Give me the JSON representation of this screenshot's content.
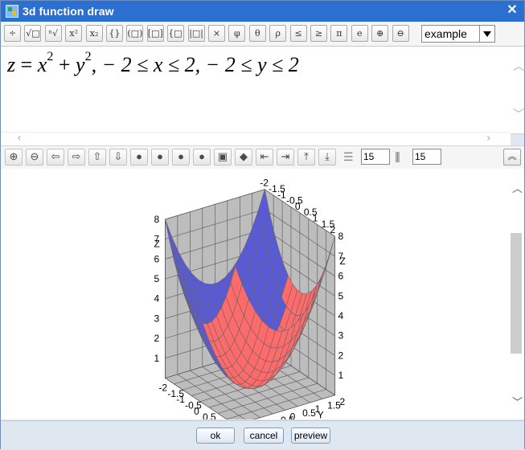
{
  "window": {
    "title": "3d function draw",
    "close_label": "✕"
  },
  "toolbar1": {
    "buttons": [
      {
        "name": "fraction-button",
        "glyph": "÷"
      },
      {
        "name": "sqrt-button",
        "glyph": "√□"
      },
      {
        "name": "nth-root-button",
        "glyph": "ⁿ√"
      },
      {
        "name": "superscript-button",
        "glyph": "x²"
      },
      {
        "name": "subscript-button",
        "glyph": "x₂"
      },
      {
        "name": "brace-button",
        "glyph": "{}"
      },
      {
        "name": "paren-button",
        "glyph": "(□)"
      },
      {
        "name": "bracket-button",
        "glyph": "[□]"
      },
      {
        "name": "curly-bracket-button",
        "glyph": "{□}"
      },
      {
        "name": "abs-button",
        "glyph": "|□|"
      },
      {
        "name": "times-button",
        "glyph": "×"
      },
      {
        "name": "phi-button",
        "glyph": "φ"
      },
      {
        "name": "theta-button",
        "glyph": "θ"
      },
      {
        "name": "rho-button",
        "glyph": "ρ"
      },
      {
        "name": "leq-button",
        "glyph": "≤"
      },
      {
        "name": "geq-button",
        "glyph": "≥"
      },
      {
        "name": "pi-button",
        "glyph": "π"
      },
      {
        "name": "e-button",
        "glyph": "e"
      },
      {
        "name": "zoom-in-button",
        "glyph": "⊕"
      },
      {
        "name": "zoom-out-button",
        "glyph": "⊖"
      }
    ],
    "example_select": "example"
  },
  "formula": {
    "z": "z",
    "eq": " = ",
    "x": "x",
    "exp1": "2",
    "plus": " + ",
    "y": "y",
    "exp2": "2",
    "rest": ", − 2 ≤ x ≤ 2, − 2 ≤ y ≤ 2"
  },
  "toolbar2": {
    "buttons": [
      {
        "name": "zoom-in-button",
        "glyph": "⊕"
      },
      {
        "name": "zoom-out-button",
        "glyph": "⊖"
      },
      {
        "name": "arrow-left-button",
        "glyph": "⇦"
      },
      {
        "name": "arrow-right-button",
        "glyph": "⇨"
      },
      {
        "name": "arrow-up-button",
        "glyph": "⇧"
      },
      {
        "name": "arrow-down-button",
        "glyph": "⇩"
      },
      {
        "name": "sphere-1-button",
        "glyph": "●"
      },
      {
        "name": "sphere-2-button",
        "glyph": "●"
      },
      {
        "name": "sphere-3-button",
        "glyph": "●"
      },
      {
        "name": "sphere-4-button",
        "glyph": "●"
      },
      {
        "name": "cube-button",
        "glyph": "▣"
      },
      {
        "name": "small-cube-button",
        "glyph": "◆"
      },
      {
        "name": "move-left-button",
        "glyph": "⇤"
      },
      {
        "name": "move-right-button",
        "glyph": "⇥"
      },
      {
        "name": "move-top-button",
        "glyph": "⤒"
      },
      {
        "name": "move-bottom-button",
        "glyph": "⤓"
      }
    ],
    "grid_x": "15",
    "grid_y": "15",
    "collapse_label": "︽"
  },
  "plot": {
    "x_axis": "X",
    "y_axis": "Y",
    "z_axis": "Z",
    "x_ticks": [
      "-2",
      "-1.5",
      "-1",
      "-0.5",
      "0",
      "0.5",
      "1",
      "1.5",
      "2"
    ],
    "y_ticks": [
      "-2",
      "-1.5",
      "-1",
      "-0.5",
      "0",
      "0.5",
      "1",
      "1.5",
      "2"
    ],
    "z_ticks": [
      "1",
      "2",
      "3",
      "4",
      "5",
      "6",
      "7",
      "8"
    ],
    "colors": {
      "top": "#ff6b6b",
      "bottom": "#5a5ad6",
      "wall": "#bdbdbd"
    }
  },
  "footer": {
    "ok": "ok",
    "cancel": "cancel",
    "preview": "preview"
  }
}
